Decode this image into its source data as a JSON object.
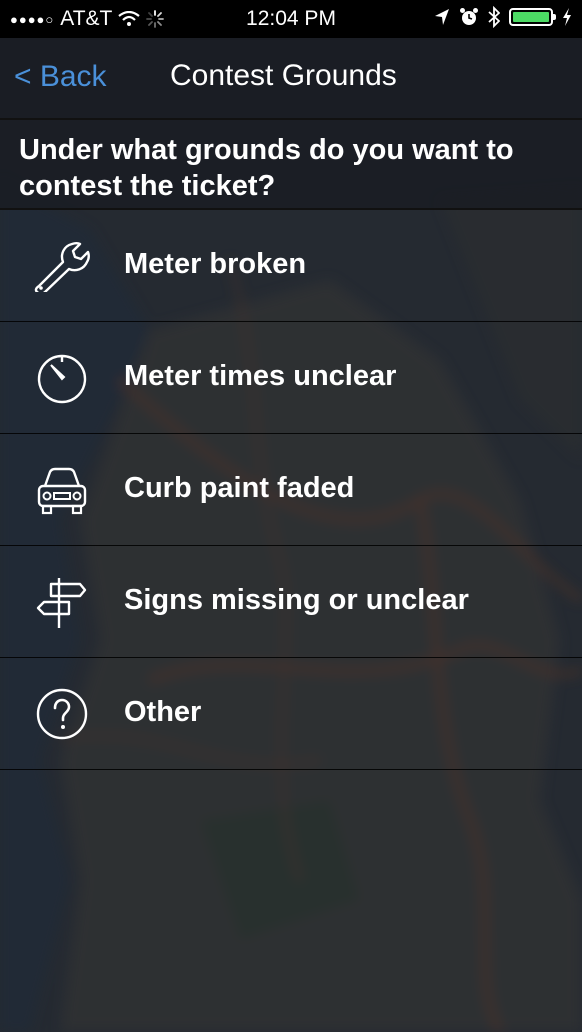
{
  "status_bar": {
    "carrier": "AT&T",
    "signal": "●●●●○",
    "time": "12:04 PM",
    "battery_color": "#4cd964"
  },
  "nav": {
    "back_label": "< Back",
    "title": "Contest Grounds"
  },
  "question": "Under what grounds do you want to contest the ticket?",
  "options": [
    {
      "label": "Meter broken",
      "icon": "wrench-icon"
    },
    {
      "label": "Meter times unclear",
      "icon": "timer-icon"
    },
    {
      "label": "Curb paint faded",
      "icon": "car-icon"
    },
    {
      "label": "Signs missing or unclear",
      "icon": "signpost-icon"
    },
    {
      "label": "Other",
      "icon": "question-icon"
    }
  ],
  "colors": {
    "accent": "#4a90d9",
    "nav_background": "#1a1d24"
  }
}
